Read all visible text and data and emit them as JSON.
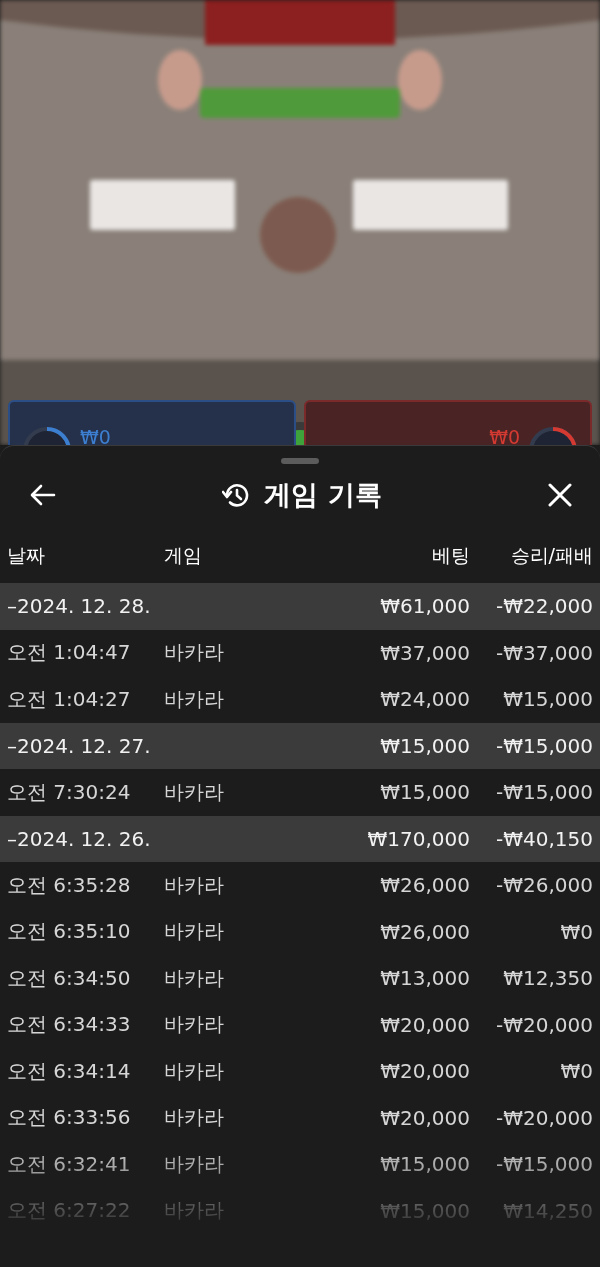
{
  "bet_panels": [
    {
      "kind": "player",
      "amount": "₩0"
    },
    {
      "kind": "banker",
      "amount": "₩0"
    }
  ],
  "sheet": {
    "title": "게임 기록",
    "columns": [
      "날짜",
      "게임",
      "베팅",
      "승리/패배"
    ],
    "rows": [
      {
        "kind": "group",
        "date": "–2024. 12. 28.",
        "bet": "₩61,000",
        "result": "-₩22,000"
      },
      {
        "kind": "item",
        "date": "오전 1:04:47",
        "game": "바카라",
        "bet": "₩37,000",
        "result": "-₩37,000"
      },
      {
        "kind": "item",
        "date": "오전 1:04:27",
        "game": "바카라",
        "bet": "₩24,000",
        "result": "₩15,000"
      },
      {
        "kind": "group",
        "date": "–2024. 12. 27.",
        "bet": "₩15,000",
        "result": "-₩15,000"
      },
      {
        "kind": "item",
        "date": "오전 7:30:24",
        "game": "바카라",
        "bet": "₩15,000",
        "result": "-₩15,000"
      },
      {
        "kind": "group",
        "date": "–2024. 12. 26.",
        "bet": "₩170,000",
        "result": "-₩40,150"
      },
      {
        "kind": "item",
        "date": "오전 6:35:28",
        "game": "바카라",
        "bet": "₩26,000",
        "result": "-₩26,000"
      },
      {
        "kind": "item",
        "date": "오전 6:35:10",
        "game": "바카라",
        "bet": "₩26,000",
        "result": "₩0"
      },
      {
        "kind": "item",
        "date": "오전 6:34:50",
        "game": "바카라",
        "bet": "₩13,000",
        "result": "₩12,350"
      },
      {
        "kind": "item",
        "date": "오전 6:34:33",
        "game": "바카라",
        "bet": "₩20,000",
        "result": "-₩20,000"
      },
      {
        "kind": "item",
        "date": "오전 6:34:14",
        "game": "바카라",
        "bet": "₩20,000",
        "result": "₩0"
      },
      {
        "kind": "item",
        "date": "오전 6:33:56",
        "game": "바카라",
        "bet": "₩20,000",
        "result": "-₩20,000"
      },
      {
        "kind": "item",
        "date": "오전 6:32:41",
        "game": "바카라",
        "bet": "₩15,000",
        "result": "-₩15,000"
      },
      {
        "kind": "item",
        "date": "오전 6:27:22",
        "game": "바카라",
        "bet": "₩15,000",
        "result": "₩14,250"
      }
    ]
  }
}
